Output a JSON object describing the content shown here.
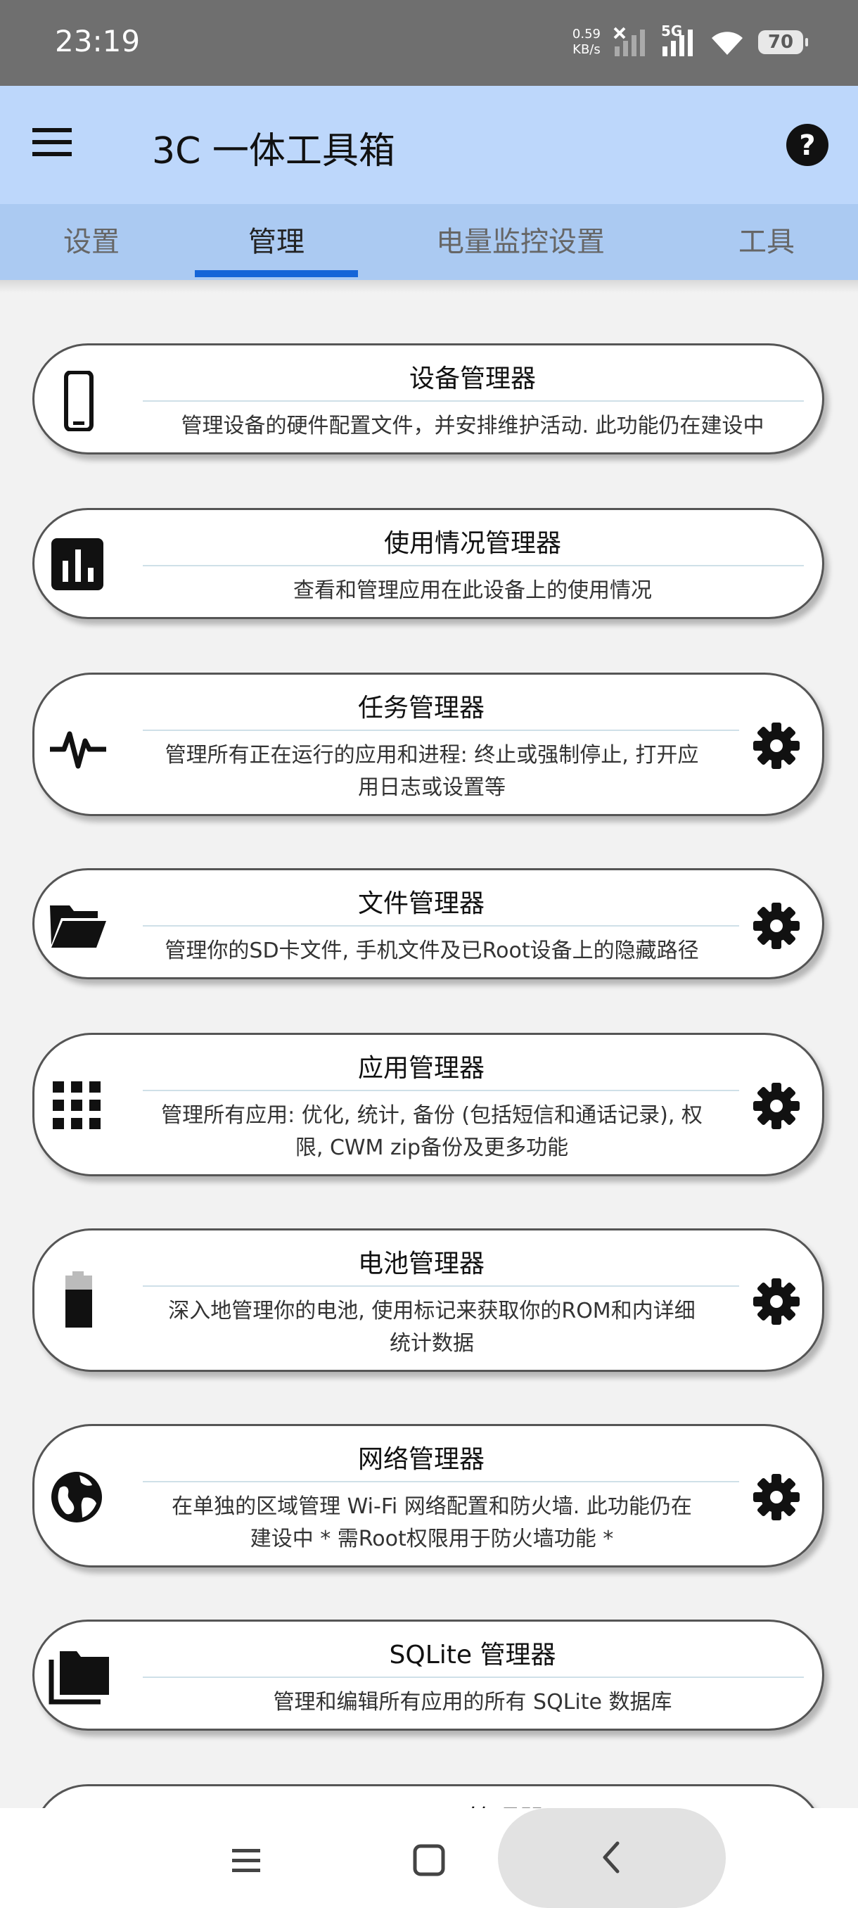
{
  "status_bar": {
    "time": "23:19",
    "net_speed_value": "0.59",
    "net_speed_unit": "KB/s",
    "network_type": "5G",
    "battery": "70"
  },
  "app_bar": {
    "title": "3C 一体工具箱",
    "menu_icon": "hamburger-menu-icon",
    "help_icon": "help-circle-icon"
  },
  "tabs": [
    {
      "label": "设置",
      "active": false
    },
    {
      "label": "管理",
      "active": true
    },
    {
      "label": "电量监控设置",
      "active": false
    },
    {
      "label": "工具",
      "active": false
    }
  ],
  "colors": {
    "app_bar_bg": "#bdd7fb",
    "tab_bar_bg": "#abcaf2",
    "tab_indicator": "#1565d8",
    "page_bg": "#f2f2f2"
  },
  "cards": [
    {
      "title": "设备管理器",
      "desc_lines": [
        "管理设备的硬件配置文件，并安排维护活动. 此功能仍在建设中"
      ],
      "icon": "smartphone-icon",
      "has_settings": false
    },
    {
      "title": "使用情况管理器",
      "desc_lines": [
        "查看和管理应用在此设备上的使用情况"
      ],
      "icon": "bar-chart-icon",
      "has_settings": false
    },
    {
      "title": "任务管理器",
      "desc_lines": [
        "管理所有正在运行的应用和进程: 终止或强制停止, 打开应",
        "用日志或设置等"
      ],
      "icon": "pulse-icon",
      "has_settings": true
    },
    {
      "title": "文件管理器",
      "desc_lines": [
        "管理你的SD卡文件, 手机文件及已Root设备上的隐藏路径"
      ],
      "icon": "folder-open-icon",
      "has_settings": true
    },
    {
      "title": "应用管理器",
      "desc_lines": [
        "管理所有应用: 优化, 统计, 备份 (包括短信和通话记录), 权",
        "限, CWM zip备份及更多功能"
      ],
      "icon": "apps-grid-icon",
      "has_settings": true
    },
    {
      "title": "电池管理器",
      "desc_lines": [
        "深入地管理你的电池, 使用标记来获取你的ROM和内详细",
        "统计数据"
      ],
      "icon": "battery-icon",
      "has_settings": true
    },
    {
      "title": "网络管理器",
      "desc_lines": [
        "在单独的区域管理 Wi-Fi 网络配置和防火墙. 此功能仍在",
        "建设中 * 需Root权限用于防火墙功能 *"
      ],
      "icon": "globe-icon",
      "has_settings": true
    },
    {
      "title": "SQLite 管理器",
      "desc_lines": [
        "管理和编辑所有应用的所有 SQLite 数据库"
      ],
      "icon": "folders-icon",
      "has_settings": false
    },
    {
      "title": "ROM 管理器",
      "desc_lines": [],
      "icon": "chevron-icon",
      "has_settings": false
    }
  ],
  "nav_bar": {
    "menu_icon": "recents-menu-icon",
    "home_icon": "home-square-icon",
    "back_icon": "back-chevron-icon"
  }
}
